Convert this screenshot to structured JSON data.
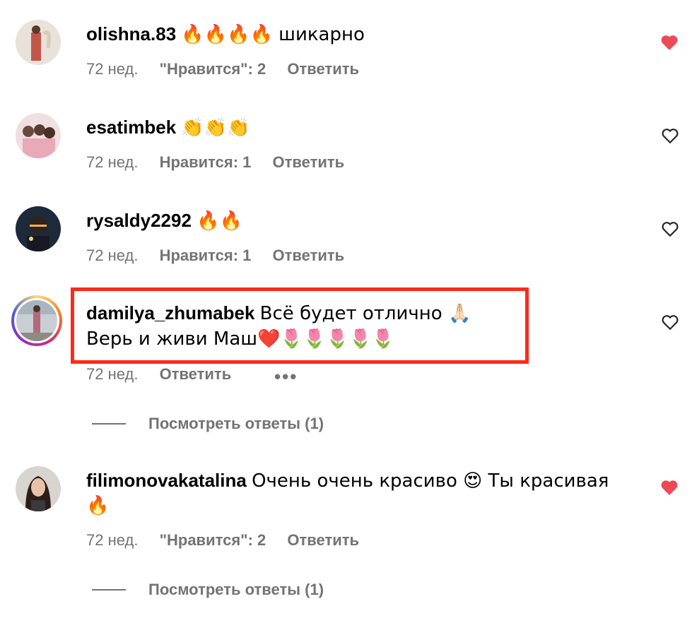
{
  "comments": [
    {
      "username": "olishna.83",
      "text": "🔥🔥🔥🔥 шикарно",
      "time": "72 нед.",
      "likes": "\"Нравится\": 2",
      "reply": "Ответить",
      "liked": true
    },
    {
      "username": "esatimbek",
      "text": "👏👏👏",
      "time": "72 нед.",
      "likes": "Нравится: 1",
      "reply": "Ответить",
      "liked": false
    },
    {
      "username": "rysaldy2292",
      "text": "🔥🔥",
      "time": "72 нед.",
      "likes": "Нравится: 1",
      "reply": "Ответить",
      "liked": false
    },
    {
      "username": "damilya_zhumabek",
      "text": "Всё будет отлично 🙏🏻",
      "text2": "Верь и живи Маш❤️🌷🌷🌷🌷🌷",
      "time": "72 нед.",
      "reply": "Ответить",
      "more": "•••",
      "view_replies": "Посмотреть ответы (1)",
      "liked": false
    },
    {
      "username": "filimonovakatalina",
      "text": "Очень очень красиво 😍 Ты красивая",
      "text2": "🔥",
      "time": "72 нед.",
      "likes": "\"Нравится\": 2",
      "reply": "Ответить",
      "view_replies": "Посмотреть ответы (1)",
      "liked": true
    }
  ],
  "colors": {
    "liked_heart": "#ed4956",
    "highlight_box": "#ff2a1a",
    "meta_text": "#737373"
  }
}
